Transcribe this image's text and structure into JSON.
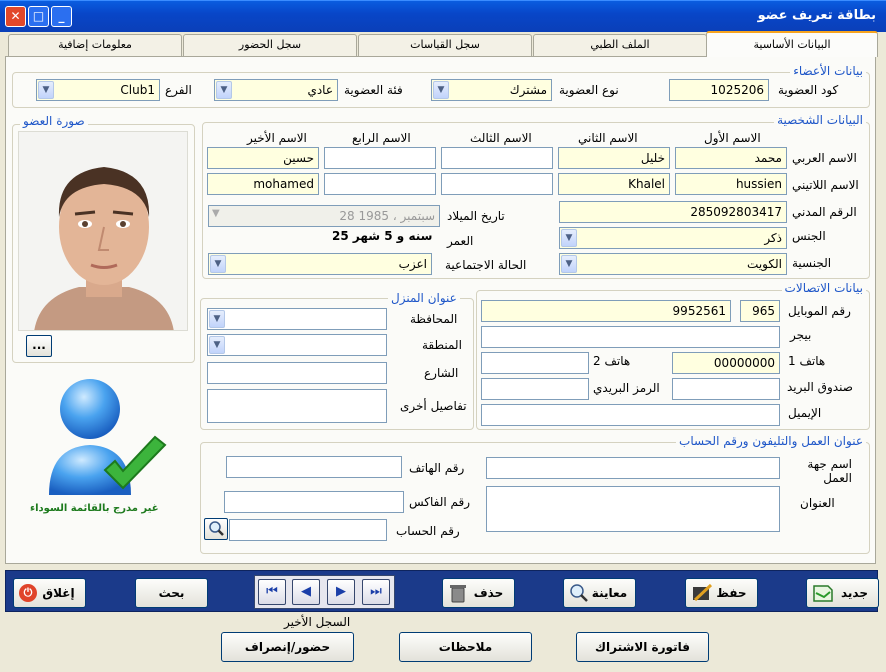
{
  "window": {
    "title": "بطاقة تعريف عضو",
    "close": "✕",
    "max": "□",
    "min": "_"
  },
  "tabs": [
    "البيانات الأساسية",
    "الملف الطبي",
    "سجل القياسات",
    "سجل الحضور",
    "معلومات إضافية"
  ],
  "members": {
    "legend": "بيانات الأعضاء",
    "code_label": "كود العضوية",
    "code": "1025206",
    "type_label": "نوع العضوية",
    "type": "مشترك",
    "category_label": "فئة العضوية",
    "category": "عادي",
    "branch_label": "الفرع",
    "branch": "Club1"
  },
  "photo": {
    "legend": "صورة العضو",
    "browse": "..."
  },
  "personal": {
    "legend": "البيانات الشخصية",
    "col_first": "الاسم الأول",
    "col_second": "الاسم الثاني",
    "col_third": "الاسم الثالث",
    "col_fourth": "الاسم الرابع",
    "col_last": "الاسم الأخير",
    "arabic_label": "الاسم العربي",
    "latin_label": "الاسم اللاتيني",
    "ar_first": "محمد",
    "ar_second": "خليل",
    "ar_third": "",
    "ar_fourth": "",
    "ar_last": "حسين",
    "la_first": "hussien",
    "la_second": "Khalel",
    "la_third": "",
    "la_fourth": "",
    "la_last": "mohamed",
    "civil_label": "الرقم المدني",
    "civil": "285092803417",
    "dob_label": "تاريخ الميلاد",
    "dob": "28   سبتمبر ، 1985",
    "age_label": "العمر",
    "age": "25 سنه و 5 شهر",
    "gender_label": "الجنس",
    "gender": "ذكر",
    "marital_label": "الحالة الاجتماعية",
    "marital": "اعزب",
    "nationality_label": "الجنسية",
    "nationality": "الكويت"
  },
  "contacts": {
    "legend": "بيانات الاتصالات",
    "mobile_label": "رقم الموبايل",
    "mobile_code": "965",
    "mobile": "9952561",
    "pager_label": "بيجر",
    "phone1_label": "هاتف 1",
    "phone1": "00000000",
    "phone2_label": "هاتف 2",
    "pobox_label": "صندوق البريد",
    "zip_label": "الرمز البريدي",
    "email_label": "الإيميل"
  },
  "home": {
    "legend": "عنوان المنزل",
    "governorate": "المحافظة",
    "region": "المنطقة",
    "street": "الشارع",
    "other": "تفاصيل أخرى"
  },
  "work": {
    "legend": "عنوان العمل والتليفون ورقم الحساب",
    "employer": "اسم جهة العمل",
    "address": "العنوان",
    "phone": "رقم الهاتف",
    "fax": "رقم الفاكس",
    "account": "رقم الحساب"
  },
  "status": {
    "text": "غير مدرج بالقائمة السوداء"
  },
  "buttons": {
    "close": "إغلاق",
    "search": "بحث",
    "delete": "حذف",
    "preview": "معاينة",
    "save": "حفظ",
    "new": "جديد",
    "last_record": "السجل الأخير",
    "attendance": "حضور/إنصراف",
    "notes": "ملاحظات",
    "invoice": "فاتورة الاشتراك"
  },
  "nav": {
    "first": "⏮",
    "prev": "◀",
    "next": "▶",
    "last": "⏭"
  },
  "colors": {
    "title_bar": "#0a5de0",
    "legend": "#1e56c8",
    "bottom_bar": "#1b3a8a",
    "yellow_field": "#ffffe0",
    "check_green": "#3cb43c"
  }
}
